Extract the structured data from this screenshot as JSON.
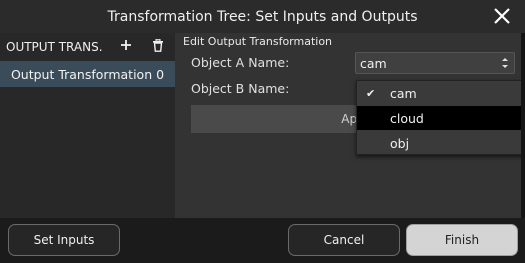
{
  "window": {
    "title": "Transformation Tree: Set Inputs and Outputs"
  },
  "left_panel": {
    "header": "OUTPUT TRANS.",
    "add_icon": "plus-icon",
    "delete_icon": "trash-icon",
    "items": [
      {
        "label": "Output Transformation 0"
      }
    ]
  },
  "editor": {
    "section_title": "Edit Output Transformation",
    "object_a_label": "Object A Name:",
    "object_a_value": "cam",
    "object_b_label": "Object B Name:",
    "apply_label": "App"
  },
  "dropdown": {
    "options": [
      {
        "label": "cam",
        "checked": true
      },
      {
        "label": "cloud",
        "checked": false
      },
      {
        "label": "obj",
        "checked": false
      }
    ],
    "check_glyph": "✔"
  },
  "footer": {
    "set_inputs": "Set Inputs",
    "cancel": "Cancel",
    "finish": "Finish"
  }
}
